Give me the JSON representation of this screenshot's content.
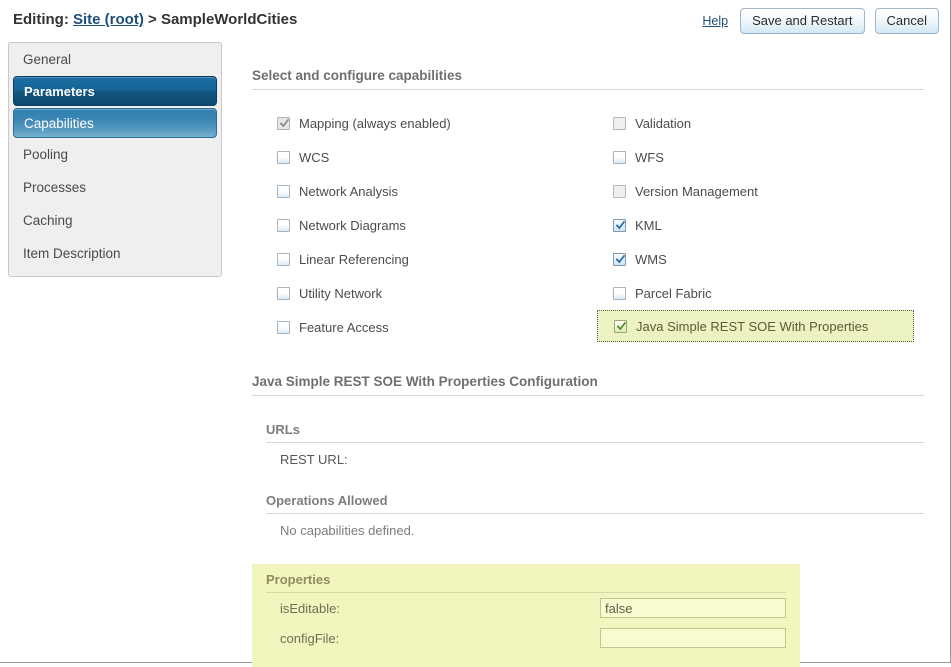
{
  "header": {
    "editing_prefix": "Editing:",
    "site_link": "Site (root)",
    "separator": ">",
    "service_name": "SampleWorldCities",
    "help_label": "Help",
    "save_label": "Save and Restart",
    "cancel_label": "Cancel"
  },
  "sidebar": {
    "items": [
      {
        "label": "General",
        "state": "normal"
      },
      {
        "label": "Parameters",
        "state": "selected-dark"
      },
      {
        "label": "Capabilities",
        "state": "selected-light"
      },
      {
        "label": "Pooling",
        "state": "normal"
      },
      {
        "label": "Processes",
        "state": "normal"
      },
      {
        "label": "Caching",
        "state": "normal"
      },
      {
        "label": "Item Description",
        "state": "normal"
      }
    ]
  },
  "main": {
    "section_title": "Select and configure capabilities",
    "capabilities_left": [
      {
        "label": "Mapping (always enabled)",
        "checked": true,
        "style": "gray-checked",
        "disabled": true
      },
      {
        "label": "WCS",
        "checked": false,
        "style": "blue-empty",
        "disabled": false
      },
      {
        "label": "Network Analysis",
        "checked": false,
        "style": "blue-empty",
        "disabled": false
      },
      {
        "label": "Network Diagrams",
        "checked": false,
        "style": "blue-empty",
        "disabled": false
      },
      {
        "label": "Linear Referencing",
        "checked": false,
        "style": "blue-empty",
        "disabled": false
      },
      {
        "label": "Utility Network",
        "checked": false,
        "style": "blue-empty",
        "disabled": false
      },
      {
        "label": "Feature Access",
        "checked": false,
        "style": "blue-empty",
        "disabled": false
      }
    ],
    "capabilities_right": [
      {
        "label": "Validation",
        "checked": false,
        "style": "gray-empty",
        "disabled": true,
        "highlighted": false
      },
      {
        "label": "WFS",
        "checked": false,
        "style": "blue-empty",
        "disabled": false,
        "highlighted": false
      },
      {
        "label": "Version Management",
        "checked": false,
        "style": "gray-empty",
        "disabled": true,
        "highlighted": false
      },
      {
        "label": "KML",
        "checked": true,
        "style": "blue-checked",
        "disabled": false,
        "highlighted": false
      },
      {
        "label": "WMS",
        "checked": true,
        "style": "blue-checked",
        "disabled": false,
        "highlighted": false
      },
      {
        "label": "Parcel Fabric",
        "checked": false,
        "style": "blue-empty",
        "disabled": false,
        "highlighted": false
      },
      {
        "label": "Java Simple REST SOE With Properties",
        "checked": true,
        "style": "green-checked",
        "disabled": false,
        "highlighted": true
      }
    ],
    "config": {
      "title": "Java Simple REST SOE With Properties Configuration",
      "urls": {
        "heading": "URLs",
        "rest_url_label": "REST URL:",
        "rest_url_value": ""
      },
      "operations": {
        "heading": "Operations Allowed",
        "empty_message": "No capabilities defined."
      },
      "properties": {
        "heading": "Properties",
        "rows": [
          {
            "label": "isEditable:",
            "value": "false"
          },
          {
            "label": "configFile:",
            "value": ""
          }
        ]
      }
    }
  },
  "colors": {
    "accent_blue": "#176294",
    "highlight_yellow": "#edf2c2",
    "props_yellow": "#f3f5bf",
    "link_blue": "#1f4e79"
  }
}
